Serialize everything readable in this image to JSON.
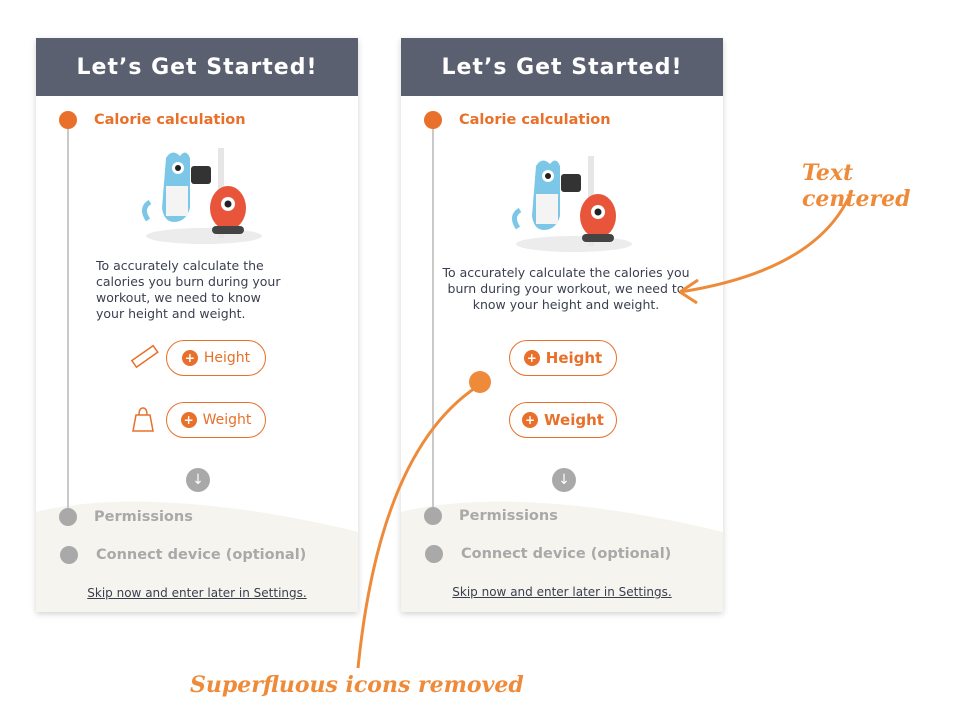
{
  "left_screen": {
    "header": "Let’s Get Started!",
    "step1": "Calorie calculation",
    "description": "To accurately calculate the calories you burn during your workout, we need to know your height and weight.",
    "height_btn": "Height",
    "weight_btn": "Weight",
    "step2": "Permissions",
    "step3": "Connect device (optional)",
    "skip": "Skip now and enter later in Settings."
  },
  "right_screen": {
    "header": "Let’s Get Started!",
    "step1": "Calorie calculation",
    "description": "To accurately calculate the calories you burn during your workout, we need to know your height and weight.",
    "height_btn": "Height",
    "weight_btn": "Weight",
    "step2": "Permissions",
    "step3": "Connect device (optional)",
    "skip": "Skip now and enter later in Settings."
  },
  "annotations": {
    "text_centered": "Text centered",
    "icons_removed": "Superfluous icons removed"
  },
  "colors": {
    "accent": "#e8702a",
    "header_bg": "#5b6070",
    "annotation": "#ee8b3a",
    "inactive": "#a9a9a9"
  }
}
